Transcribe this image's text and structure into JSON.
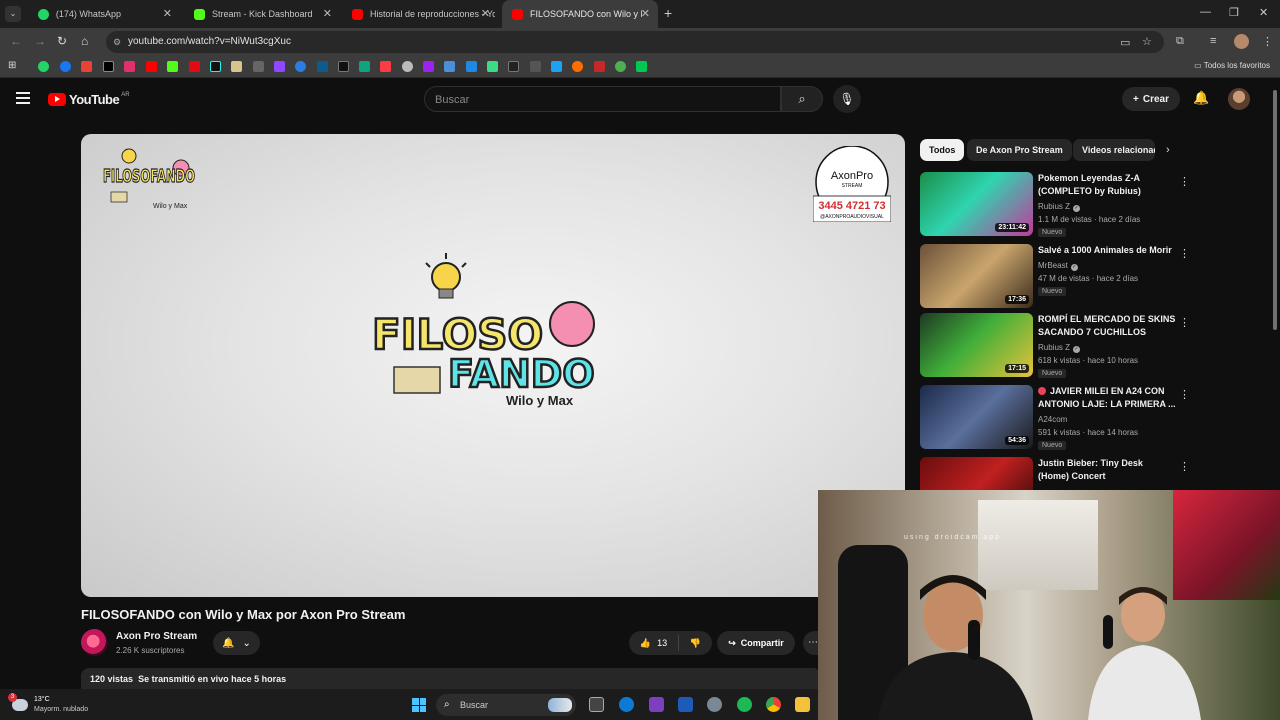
{
  "browser": {
    "tabs": [
      {
        "title": "(174) WhatsApp",
        "favicon": "whatsapp-icon",
        "color": "#25d366",
        "active": false
      },
      {
        "title": "Stream - Kick Dashboard",
        "favicon": "kick-icon",
        "color": "#53fc18",
        "active": false
      },
      {
        "title": "Historial de reproducciones - Yo",
        "favicon": "youtube-icon",
        "color": "#ff0000",
        "active": false
      },
      {
        "title": "FILOSOFANDO con Wilo y Max",
        "favicon": "youtube-icon",
        "color": "#ff0000",
        "active": true
      }
    ],
    "url": "youtube.com/watch?v=NiWut3cgXuc",
    "bookmarks_all": "Todos los favoritos",
    "bookmark_icons": [
      "whatsapp-icon",
      "facebook-icon",
      "gmail-icon",
      "x-icon",
      "instagram-icon",
      "youtube-icon",
      "kick-icon",
      "netflix-icon",
      "tiktok-icon",
      "app-icon",
      "app-icon",
      "twitch-icon",
      "app-icon",
      "app-icon",
      "app-icon",
      "app-icon",
      "app-icon",
      "app-icon",
      "music-icon",
      "app-icon",
      "app-icon",
      "app-icon",
      "app-icon",
      "app-icon",
      "app-icon",
      "app-icon",
      "app-icon",
      "app-icon",
      "app-icon",
      "app-icon",
      "app-icon"
    ]
  },
  "youtube": {
    "logo": "YouTube",
    "country": "AR",
    "search_placeholder": "Buscar",
    "create_label": "Crear"
  },
  "player": {
    "corner_logo_text": "FILOSOFANDO",
    "center_logo_line1": "FILOSO",
    "center_logo_line2": "FANDO",
    "center_logo_sub": "Wilo y Max",
    "brand_name": "AxonPro",
    "brand_sub": "STREAM",
    "brand_phone": "3445 4721 73",
    "brand_handle": "@AXONPROAUDIOVISUAL"
  },
  "video": {
    "title": "FILOSOFANDO con Wilo y Max por Axon Pro Stream",
    "channel": "Axon Pro Stream",
    "subscribers": "2.26 K suscriptores",
    "likes": "13",
    "share_label": "Compartir",
    "views": "120 vistas",
    "streamed": "Se transmitió en vivo hace 5 horas"
  },
  "chips": [
    "Todos",
    "De Axon Pro Stream",
    "Videos relacionados"
  ],
  "recommendations": [
    {
      "title": "Pokemon Leyendas Z-A (COMPLETO by Rubius)",
      "channel": "Rubius Z",
      "verified": true,
      "meta": "1.1 M de vistas · hace 2 días",
      "badge": "Nuevo",
      "duration": "23:11:42",
      "live": false
    },
    {
      "title": "Salvé a 1000 Animales de Morir",
      "channel": "MrBeast",
      "verified": true,
      "meta": "47 M de vistas · hace 2 días",
      "badge": "Nuevo",
      "duration": "17:36",
      "live": false
    },
    {
      "title": "ROMPÍ EL MERCADO DE SKINS SACANDO 7 CUCHILLOS",
      "channel": "Rubius Z",
      "verified": true,
      "meta": "618 k vistas · hace 10 horas",
      "badge": "Nuevo",
      "duration": "17:15",
      "live": false
    },
    {
      "title": "JAVIER MILEI EN A24 CON ANTONIO LAJE: LA PRIMERA ...",
      "channel": "A24com",
      "verified": false,
      "meta": "591 k vistas · hace 14 horas",
      "badge": "Nuevo",
      "duration": "54:36",
      "live": true
    },
    {
      "title": "Justin Bieber: Tiny Desk (Home) Concert",
      "channel": "",
      "verified": false,
      "meta": "",
      "badge": "",
      "duration": "",
      "live": false
    }
  ],
  "webcam": {
    "watermark": "using droidcam app"
  },
  "taskbar": {
    "temperature": "13°C",
    "condition": "Mayorm. nublado",
    "notifications": "3",
    "search_placeholder": "Buscar"
  }
}
